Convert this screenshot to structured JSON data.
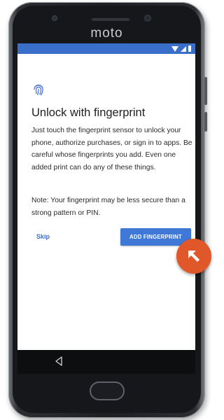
{
  "device": {
    "brand": "moto"
  },
  "status_bar": {
    "color": "#3a6fc9",
    "icons": [
      "wifi-icon",
      "signal-icon",
      "battery-icon"
    ]
  },
  "screen": {
    "icon": "fingerprint-icon",
    "title": "Unlock with fingerprint",
    "body": "Just touch the fingerprint sensor to unlock your phone, authorize purchases, or sign in to apps. Be careful whose fingerprints you add. Even one added print can do any of these things.",
    "note": "Note: Your fingerprint may be less secure than a strong pattern or PIN.",
    "skip_label": "Skip",
    "add_label": "ADD FINGERPRINT",
    "accent": "#3f78d6"
  },
  "nav_bar": {
    "back_icon": "back-triangle-icon"
  },
  "overlay": {
    "icon": "arrow-up-left-icon",
    "color": "#e0582a"
  }
}
